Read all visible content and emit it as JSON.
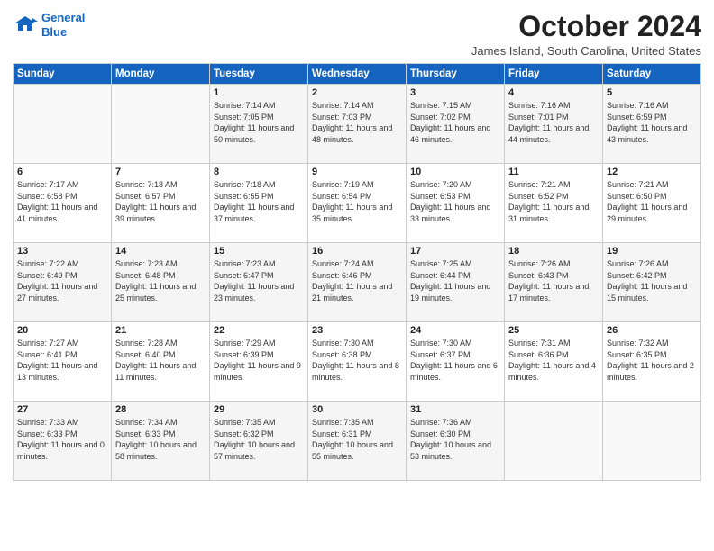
{
  "logo": {
    "line1": "General",
    "line2": "Blue"
  },
  "title": "October 2024",
  "location": "James Island, South Carolina, United States",
  "days_of_week": [
    "Sunday",
    "Monday",
    "Tuesday",
    "Wednesday",
    "Thursday",
    "Friday",
    "Saturday"
  ],
  "weeks": [
    [
      {
        "day": "",
        "sunrise": "",
        "sunset": "",
        "daylight": ""
      },
      {
        "day": "",
        "sunrise": "",
        "sunset": "",
        "daylight": ""
      },
      {
        "day": "1",
        "sunrise": "Sunrise: 7:14 AM",
        "sunset": "Sunset: 7:05 PM",
        "daylight": "Daylight: 11 hours and 50 minutes."
      },
      {
        "day": "2",
        "sunrise": "Sunrise: 7:14 AM",
        "sunset": "Sunset: 7:03 PM",
        "daylight": "Daylight: 11 hours and 48 minutes."
      },
      {
        "day": "3",
        "sunrise": "Sunrise: 7:15 AM",
        "sunset": "Sunset: 7:02 PM",
        "daylight": "Daylight: 11 hours and 46 minutes."
      },
      {
        "day": "4",
        "sunrise": "Sunrise: 7:16 AM",
        "sunset": "Sunset: 7:01 PM",
        "daylight": "Daylight: 11 hours and 44 minutes."
      },
      {
        "day": "5",
        "sunrise": "Sunrise: 7:16 AM",
        "sunset": "Sunset: 6:59 PM",
        "daylight": "Daylight: 11 hours and 43 minutes."
      }
    ],
    [
      {
        "day": "6",
        "sunrise": "Sunrise: 7:17 AM",
        "sunset": "Sunset: 6:58 PM",
        "daylight": "Daylight: 11 hours and 41 minutes."
      },
      {
        "day": "7",
        "sunrise": "Sunrise: 7:18 AM",
        "sunset": "Sunset: 6:57 PM",
        "daylight": "Daylight: 11 hours and 39 minutes."
      },
      {
        "day": "8",
        "sunrise": "Sunrise: 7:18 AM",
        "sunset": "Sunset: 6:55 PM",
        "daylight": "Daylight: 11 hours and 37 minutes."
      },
      {
        "day": "9",
        "sunrise": "Sunrise: 7:19 AM",
        "sunset": "Sunset: 6:54 PM",
        "daylight": "Daylight: 11 hours and 35 minutes."
      },
      {
        "day": "10",
        "sunrise": "Sunrise: 7:20 AM",
        "sunset": "Sunset: 6:53 PM",
        "daylight": "Daylight: 11 hours and 33 minutes."
      },
      {
        "day": "11",
        "sunrise": "Sunrise: 7:21 AM",
        "sunset": "Sunset: 6:52 PM",
        "daylight": "Daylight: 11 hours and 31 minutes."
      },
      {
        "day": "12",
        "sunrise": "Sunrise: 7:21 AM",
        "sunset": "Sunset: 6:50 PM",
        "daylight": "Daylight: 11 hours and 29 minutes."
      }
    ],
    [
      {
        "day": "13",
        "sunrise": "Sunrise: 7:22 AM",
        "sunset": "Sunset: 6:49 PM",
        "daylight": "Daylight: 11 hours and 27 minutes."
      },
      {
        "day": "14",
        "sunrise": "Sunrise: 7:23 AM",
        "sunset": "Sunset: 6:48 PM",
        "daylight": "Daylight: 11 hours and 25 minutes."
      },
      {
        "day": "15",
        "sunrise": "Sunrise: 7:23 AM",
        "sunset": "Sunset: 6:47 PM",
        "daylight": "Daylight: 11 hours and 23 minutes."
      },
      {
        "day": "16",
        "sunrise": "Sunrise: 7:24 AM",
        "sunset": "Sunset: 6:46 PM",
        "daylight": "Daylight: 11 hours and 21 minutes."
      },
      {
        "day": "17",
        "sunrise": "Sunrise: 7:25 AM",
        "sunset": "Sunset: 6:44 PM",
        "daylight": "Daylight: 11 hours and 19 minutes."
      },
      {
        "day": "18",
        "sunrise": "Sunrise: 7:26 AM",
        "sunset": "Sunset: 6:43 PM",
        "daylight": "Daylight: 11 hours and 17 minutes."
      },
      {
        "day": "19",
        "sunrise": "Sunrise: 7:26 AM",
        "sunset": "Sunset: 6:42 PM",
        "daylight": "Daylight: 11 hours and 15 minutes."
      }
    ],
    [
      {
        "day": "20",
        "sunrise": "Sunrise: 7:27 AM",
        "sunset": "Sunset: 6:41 PM",
        "daylight": "Daylight: 11 hours and 13 minutes."
      },
      {
        "day": "21",
        "sunrise": "Sunrise: 7:28 AM",
        "sunset": "Sunset: 6:40 PM",
        "daylight": "Daylight: 11 hours and 11 minutes."
      },
      {
        "day": "22",
        "sunrise": "Sunrise: 7:29 AM",
        "sunset": "Sunset: 6:39 PM",
        "daylight": "Daylight: 11 hours and 9 minutes."
      },
      {
        "day": "23",
        "sunrise": "Sunrise: 7:30 AM",
        "sunset": "Sunset: 6:38 PM",
        "daylight": "Daylight: 11 hours and 8 minutes."
      },
      {
        "day": "24",
        "sunrise": "Sunrise: 7:30 AM",
        "sunset": "Sunset: 6:37 PM",
        "daylight": "Daylight: 11 hours and 6 minutes."
      },
      {
        "day": "25",
        "sunrise": "Sunrise: 7:31 AM",
        "sunset": "Sunset: 6:36 PM",
        "daylight": "Daylight: 11 hours and 4 minutes."
      },
      {
        "day": "26",
        "sunrise": "Sunrise: 7:32 AM",
        "sunset": "Sunset: 6:35 PM",
        "daylight": "Daylight: 11 hours and 2 minutes."
      }
    ],
    [
      {
        "day": "27",
        "sunrise": "Sunrise: 7:33 AM",
        "sunset": "Sunset: 6:33 PM",
        "daylight": "Daylight: 11 hours and 0 minutes."
      },
      {
        "day": "28",
        "sunrise": "Sunrise: 7:34 AM",
        "sunset": "Sunset: 6:33 PM",
        "daylight": "Daylight: 10 hours and 58 minutes."
      },
      {
        "day": "29",
        "sunrise": "Sunrise: 7:35 AM",
        "sunset": "Sunset: 6:32 PM",
        "daylight": "Daylight: 10 hours and 57 minutes."
      },
      {
        "day": "30",
        "sunrise": "Sunrise: 7:35 AM",
        "sunset": "Sunset: 6:31 PM",
        "daylight": "Daylight: 10 hours and 55 minutes."
      },
      {
        "day": "31",
        "sunrise": "Sunrise: 7:36 AM",
        "sunset": "Sunset: 6:30 PM",
        "daylight": "Daylight: 10 hours and 53 minutes."
      },
      {
        "day": "",
        "sunrise": "",
        "sunset": "",
        "daylight": ""
      },
      {
        "day": "",
        "sunrise": "",
        "sunset": "",
        "daylight": ""
      }
    ]
  ]
}
